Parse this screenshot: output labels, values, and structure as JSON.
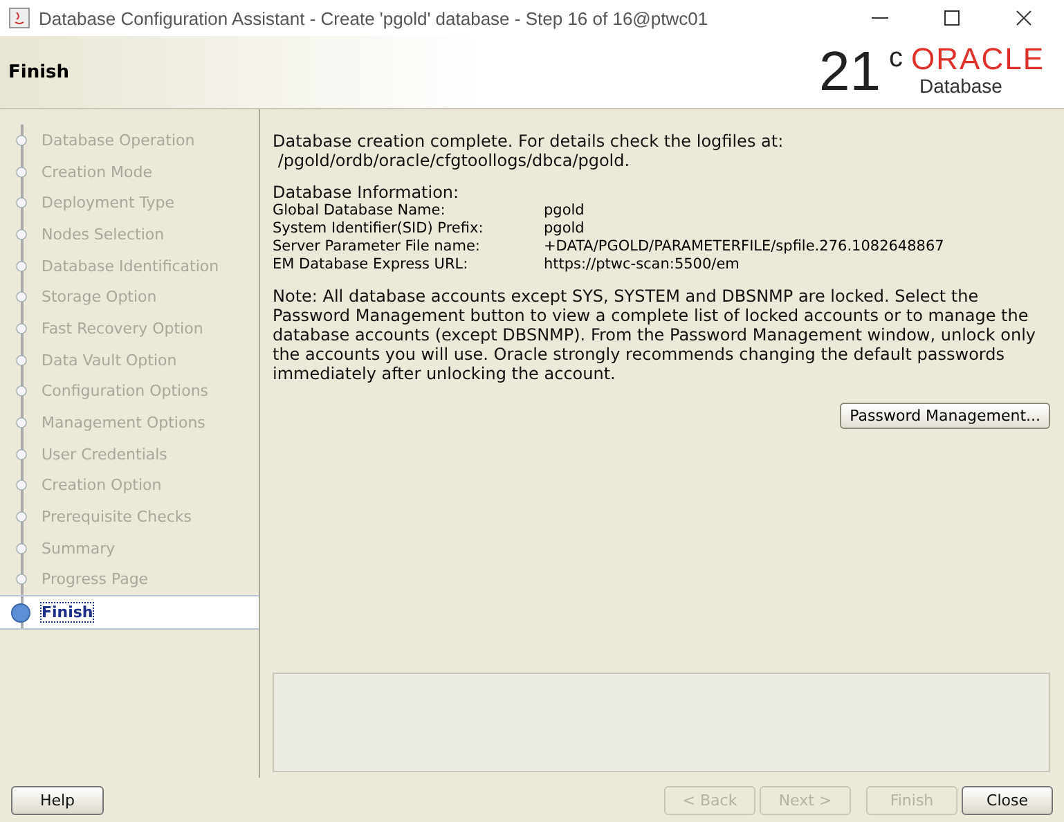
{
  "window": {
    "title": "Database Configuration Assistant - Create 'pgold' database - Step 16 of 16@ptwc01"
  },
  "header": {
    "title": "Finish",
    "logo_version": "21",
    "logo_superscript": "c",
    "logo_brand": "ORACLE",
    "logo_product": "Database"
  },
  "steps": [
    {
      "label": "Database Operation",
      "selected": false
    },
    {
      "label": "Creation Mode",
      "selected": false
    },
    {
      "label": "Deployment Type",
      "selected": false
    },
    {
      "label": "Nodes Selection",
      "selected": false
    },
    {
      "label": "Database Identification",
      "selected": false
    },
    {
      "label": "Storage Option",
      "selected": false
    },
    {
      "label": "Fast Recovery Option",
      "selected": false
    },
    {
      "label": "Data Vault Option",
      "selected": false
    },
    {
      "label": "Configuration Options",
      "selected": false
    },
    {
      "label": "Management Options",
      "selected": false
    },
    {
      "label": "User Credentials",
      "selected": false
    },
    {
      "label": "Creation Option",
      "selected": false
    },
    {
      "label": "Prerequisite Checks",
      "selected": false
    },
    {
      "label": "Summary",
      "selected": false
    },
    {
      "label": "Progress Page",
      "selected": false
    },
    {
      "label": "Finish",
      "selected": true
    }
  ],
  "content": {
    "intro": [
      "Database creation complete. For details check the logfiles at:",
      " /pgold/ordb/oracle/cfgtoollogs/dbca/pgold."
    ],
    "info_heading": "Database Information:",
    "info": [
      {
        "label": "Global Database Name:",
        "value": "pgold"
      },
      {
        "label": "System Identifier(SID) Prefix:",
        "value": "pgold"
      },
      {
        "label": "Server Parameter File name:",
        "value": "+DATA/PGOLD/PARAMETERFILE/spfile.276.1082648867"
      },
      {
        "label": "EM Database Express URL:",
        "value": "https://ptwc-scan:5500/em"
      }
    ],
    "note": "Note: All database accounts except SYS, SYSTEM and DBSNMP are locked. Select the Password Management button to view a complete list of locked accounts or to manage the database accounts (except DBSNMP). From the Password Management window, unlock only the accounts you will use. Oracle strongly recommends changing the default passwords immediately after unlocking the account.",
    "button": "Password Management..."
  },
  "footer": {
    "help": "Help",
    "buttons": [
      {
        "label": "< Back",
        "disabled": true
      },
      {
        "label": "Next >",
        "disabled": true
      },
      {
        "label": "Finish",
        "disabled": true
      },
      {
        "label": "Close",
        "disabled": false
      }
    ]
  }
}
